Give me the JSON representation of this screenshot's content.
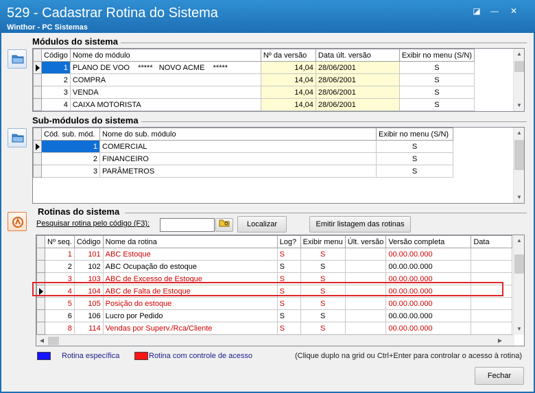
{
  "window": {
    "title": "529 - Cadastrar Rotina do Sistema",
    "subtitle": "Winthor - PC Sistemas",
    "btn_restore": "◪",
    "btn_minimize": "—",
    "btn_close": "✕"
  },
  "modulos": {
    "title": "Módulos do sistema",
    "columns": [
      "Código",
      "Nome do módulo",
      "Nº da versão",
      "Data últ. versão",
      "Exibir no menu (S/N)"
    ],
    "rows": [
      {
        "codigo": "1",
        "nome": "PLANO DE VOO    *****   NOVO ACME    *****",
        "versao": "14,04",
        "data": "28/06/2001",
        "exibir": "S"
      },
      {
        "codigo": "2",
        "nome": "COMPRA",
        "versao": "14,04",
        "data": "28/06/2001",
        "exibir": "S"
      },
      {
        "codigo": "3",
        "nome": "VENDA",
        "versao": "14,04",
        "data": "28/06/2001",
        "exibir": "S"
      },
      {
        "codigo": "4",
        "nome": "CAIXA MOTORISTA",
        "versao": "14,04",
        "data": "28/06/2001",
        "exibir": "S"
      }
    ]
  },
  "submodulos": {
    "title": "Sub-módulos do sistema",
    "columns": [
      "Cód. sub. mód.",
      "Nome do sub. módulo",
      "Exibir no menu (S/N)"
    ],
    "rows": [
      {
        "codigo": "1",
        "nome": "COMERCIAL",
        "exibir": "S"
      },
      {
        "codigo": "2",
        "nome": "FINANCEIRO",
        "exibir": "S"
      },
      {
        "codigo": "3",
        "nome": "PARÂMETROS",
        "exibir": "S"
      }
    ]
  },
  "rotinas": {
    "title": "Rotinas do sistema",
    "search_label": "Pesquisar rotina pelo código (F3):",
    "search_value": "",
    "btn_localizar": "Localizar",
    "btn_emitir": "Emitir listagem das rotinas",
    "columns": [
      "Nº seq.",
      "Código",
      "Nome da rotina",
      "Log?",
      "Exibir menu",
      "Últ. versão",
      "Versão completa",
      "Data"
    ],
    "rows": [
      {
        "seq": "1",
        "codigo": "101",
        "nome": "ABC Estoque",
        "log": "S",
        "exibir": "S",
        "ult": "",
        "versao": "00.00.00.000",
        "data": "",
        "red": true
      },
      {
        "seq": "2",
        "codigo": "102",
        "nome": "ABC Ocupação do estoque",
        "log": "S",
        "exibir": "S",
        "ult": "",
        "versao": "00.00.00.000",
        "data": "",
        "red": false
      },
      {
        "seq": "3",
        "codigo": "103",
        "nome": "ABC de Excesso de Estoque",
        "log": "S",
        "exibir": "S",
        "ult": "",
        "versao": "00.00.00.000",
        "data": "",
        "red": true
      },
      {
        "seq": "4",
        "codigo": "104",
        "nome": "ABC de Falta de Estoque",
        "log": "S",
        "exibir": "S",
        "ult": "",
        "versao": "00.00.00.000",
        "data": "",
        "red": true
      },
      {
        "seq": "5",
        "codigo": "105",
        "nome": "Posição do estoque",
        "log": "S",
        "exibir": "S",
        "ult": "",
        "versao": "00.00.00.000",
        "data": "",
        "red": true
      },
      {
        "seq": "6",
        "codigo": "106",
        "nome": "Lucro por Pedido",
        "log": "S",
        "exibir": "S",
        "ult": "",
        "versao": "00.00.00.000",
        "data": "",
        "red": false
      },
      {
        "seq": "8",
        "codigo": "114",
        "nome": "Vendas por Superv./Rca/Cliente",
        "log": "S",
        "exibir": "S",
        "ult": "",
        "versao": "00.00.00.000",
        "data": "",
        "red": true
      }
    ]
  },
  "legend": {
    "especifica": "Rotina específica",
    "controle": "Rotina com controle de acesso",
    "hint": "(Clique duplo na grid ou Ctrl+Enter para controlar o acesso à rotina)",
    "color_blue": "#1414ff",
    "color_red": "#ff1414"
  },
  "footer": {
    "btn_fechar": "Fechar"
  }
}
